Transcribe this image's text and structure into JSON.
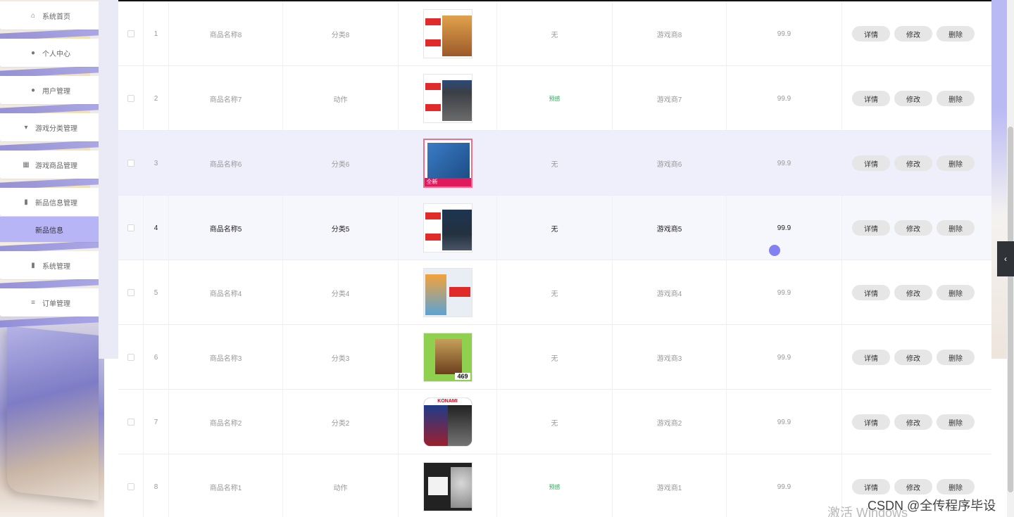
{
  "sidebar": {
    "items": [
      {
        "label": "系统首页",
        "icon": "home-icon",
        "glyph": "⌂"
      },
      {
        "label": "个人中心",
        "icon": "user-icon",
        "glyph": "●"
      },
      {
        "label": "用户管理",
        "icon": "user-icon",
        "glyph": "●"
      },
      {
        "label": "游戏分类管理",
        "icon": "category-icon",
        "glyph": "▾"
      },
      {
        "label": "游戏商品管理",
        "icon": "grid-icon",
        "glyph": "▦"
      },
      {
        "label": "新品信息管理",
        "icon": "chart-icon",
        "glyph": "▮"
      },
      {
        "label": "新品信息",
        "icon": "",
        "glyph": ""
      },
      {
        "label": "系统管理",
        "icon": "bar-chart-icon",
        "glyph": "▮"
      },
      {
        "label": "订单管理",
        "icon": "settings-icon",
        "glyph": "≡"
      }
    ],
    "active_index": 6
  },
  "table": {
    "rows": [
      {
        "index": "1",
        "name": "商品名称8",
        "category": "分类8",
        "tag": "无",
        "vendor": "游戏商8",
        "price": "99.9",
        "cover_color": "#c9893e"
      },
      {
        "index": "2",
        "name": "商品名称7",
        "category": "动作",
        "tag": "预感",
        "vendor": "游戏商7",
        "price": "99.9",
        "cover_color": "#3b3f44"
      },
      {
        "index": "3",
        "name": "商品名称6",
        "category": "分类6",
        "tag": "无",
        "vendor": "游戏商6",
        "price": "99.9",
        "cover_color": "#2b6fb0"
      },
      {
        "index": "4",
        "name": "商品名称5",
        "category": "分类5",
        "tag": "无",
        "vendor": "游戏商5",
        "price": "99.9",
        "cover_color": "#23313f"
      },
      {
        "index": "5",
        "name": "商品名称4",
        "category": "分类4",
        "tag": "无",
        "vendor": "游戏商4",
        "price": "99.9",
        "cover_color": "#5aa3d6"
      },
      {
        "index": "6",
        "name": "商品名称3",
        "category": "分类3",
        "tag": "无",
        "vendor": "游戏商3",
        "price": "99.9",
        "cover_color": "#8b5a2b"
      },
      {
        "index": "7",
        "name": "商品名称2",
        "category": "分类2",
        "tag": "无",
        "vendor": "游戏商2",
        "price": "99.9",
        "cover_color": "#1f3c88"
      },
      {
        "index": "8",
        "name": "商品名称1",
        "category": "动作",
        "tag": "预感",
        "vendor": "游戏商1",
        "price": "99.9",
        "cover_color": "#222222"
      }
    ],
    "buttons": {
      "detail": "详情",
      "edit": "修改",
      "delete": "删除"
    }
  },
  "thumb_texts": {
    "row3_badge": "全新",
    "row6_price": "469",
    "row7_brand": "KONAMI"
  },
  "watermark": {
    "activate": "激活 Windows",
    "csdn": "CSDN @全传程序毕设"
  },
  "colors": {
    "accent": "#b8b5f7",
    "ribbon": "#8b88d8",
    "green_tag": "#2fa85a"
  }
}
